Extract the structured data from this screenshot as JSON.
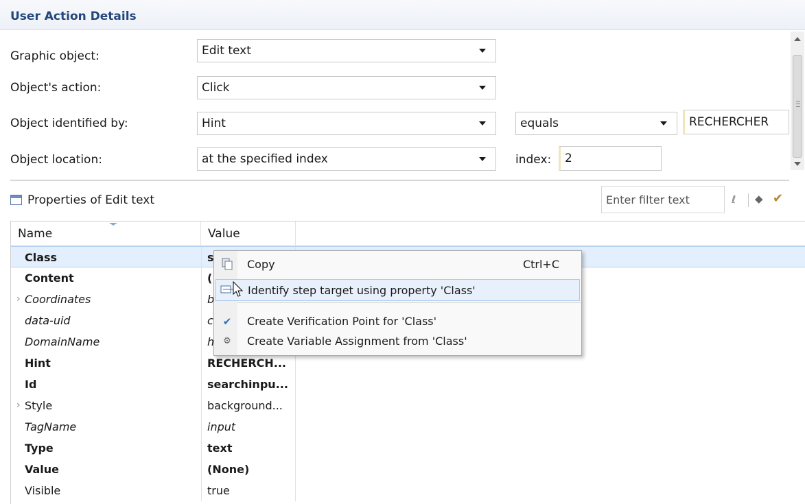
{
  "details": {
    "title": "User Action Details",
    "graphic_object": {
      "label": "Graphic object:",
      "value": "Edit text"
    },
    "object_action": {
      "label": "Object's action:",
      "value": "Click"
    },
    "identified_by": {
      "label": "Object identified by:",
      "value": "Hint",
      "operator": "equals",
      "text": "RECHERCHER"
    },
    "location": {
      "label": "Object location:",
      "value": "at the specified index",
      "index_label": "index:",
      "index_value": "2"
    }
  },
  "properties": {
    "title": "Properties of Edit text",
    "filter_placeholder": "Enter filter text",
    "columns": {
      "name": "Name",
      "value": "Value"
    },
    "rows": [
      {
        "name": "Class",
        "value": "s",
        "style": "bold",
        "selected": true
      },
      {
        "name": "Content",
        "value": "(",
        "style": "bold"
      },
      {
        "name": "Coordinates",
        "value": "b",
        "style": "italic",
        "expandable": true
      },
      {
        "name": "data-uid",
        "value": "c",
        "style": "italic"
      },
      {
        "name": "DomainName",
        "value": "h",
        "style": "italic"
      },
      {
        "name": "Hint",
        "value": "RECHERCH...",
        "style": "bold"
      },
      {
        "name": "Id",
        "value": "searchinpu...",
        "style": "bold"
      },
      {
        "name": "Style",
        "value": "background...",
        "style": "normal",
        "expandable": true
      },
      {
        "name": "TagName",
        "value": "input",
        "style": "italic"
      },
      {
        "name": "Type",
        "value": "text",
        "style": "bold"
      },
      {
        "name": "Value",
        "value": "(None)",
        "style": "bold"
      },
      {
        "name": "Visible",
        "value": "true",
        "style": "normal"
      }
    ]
  },
  "context_menu": {
    "items": [
      {
        "label": "Copy",
        "shortcut": "Ctrl+C",
        "icon": "copy-icon"
      },
      {
        "label": "Identify step target using property 'Class'",
        "icon": "identify-target-icon",
        "highlighted": true
      },
      {
        "label": "Create Verification Point for 'Class'",
        "icon": "checkmark-icon"
      },
      {
        "label": "Create Variable Assignment from 'Class'",
        "icon": "variable-icon"
      }
    ]
  },
  "colors": {
    "header_text": "#23467b",
    "selection": "#e3effc",
    "menu_highlight": "#e8f1fb"
  }
}
